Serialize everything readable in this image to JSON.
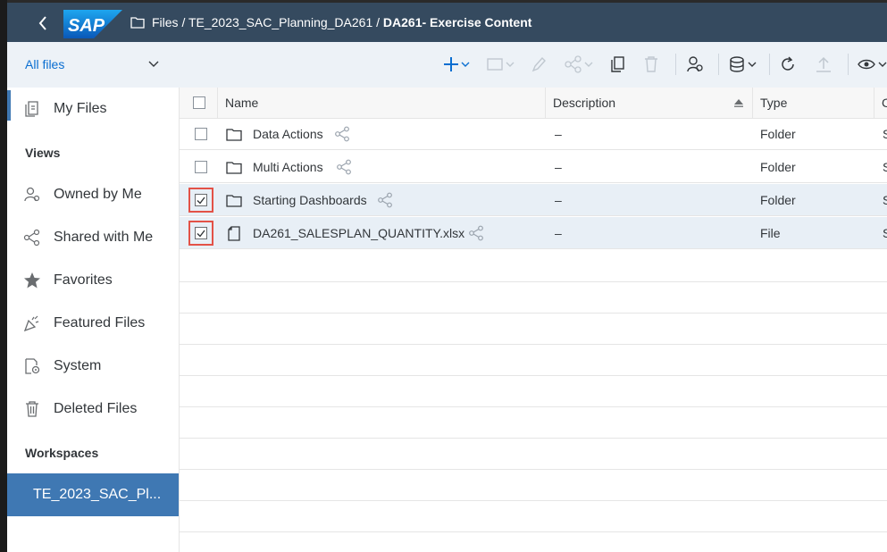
{
  "header": {
    "breadcrumb_path": "Files / TE_2023_SAC_Planning_DA261 / ",
    "breadcrumb_current": "DA261- Exercise Content",
    "logo_text": "SAP",
    "brand_color": "#354a5f"
  },
  "toolbar": {
    "filter_label": "All files",
    "icons": [
      "add-icon",
      "new-folder-icon",
      "edit-icon",
      "share-icon",
      "copy-icon",
      "delete-icon",
      "share-settings-icon",
      "data-source-icon",
      "refresh-icon",
      "upload-icon",
      "view-icon"
    ]
  },
  "sidebar": {
    "my_files": "My Files",
    "views_heading": "Views",
    "items": [
      {
        "label": "Owned by Me",
        "icon": "owned-icon"
      },
      {
        "label": "Shared with Me",
        "icon": "share-icon"
      },
      {
        "label": "Favorites",
        "icon": "star-icon"
      },
      {
        "label": "Featured Files",
        "icon": "featured-icon"
      },
      {
        "label": "System",
        "icon": "system-icon"
      },
      {
        "label": "Deleted Files",
        "icon": "trash-icon"
      }
    ],
    "workspaces_heading": "Workspaces",
    "active_workspace": "TE_2023_SAC_Pl..."
  },
  "table": {
    "columns": [
      "Name",
      "Description",
      "Type",
      "C"
    ],
    "rows": [
      {
        "name": "Data Actions",
        "description": "–",
        "type": "Folder",
        "selected": false,
        "icon": "folder-icon"
      },
      {
        "name": "Multi Actions",
        "description": "–",
        "type": "Folder",
        "selected": false,
        "icon": "folder-icon"
      },
      {
        "name": "Starting Dashboards",
        "description": "–",
        "type": "Folder",
        "selected": true,
        "icon": "folder-icon"
      },
      {
        "name": "DA261_SALESPLAN_QUANTITY.xlsx",
        "description": "–",
        "type": "File",
        "selected": true,
        "icon": "file-icon"
      }
    ],
    "trailing_partial_cell": "S"
  }
}
